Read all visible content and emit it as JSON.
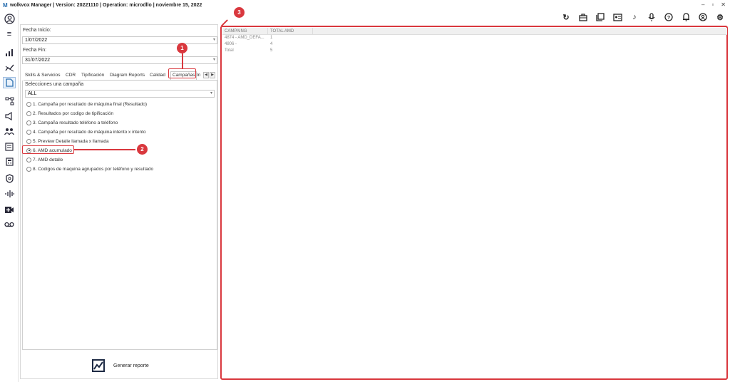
{
  "window": {
    "logo_letter": "M",
    "title": "wolkvox Manager  | Version: 20221110  |  Operation: microdllo  | noviembre 15, 2022",
    "controls": [
      "–",
      "▫",
      "✕"
    ]
  },
  "toolbar_icons": [
    "refresh-icon",
    "briefcase-icon",
    "book-icon",
    "contact-card-icon",
    "music-icon",
    "microphone-icon",
    "help-icon",
    "bell-icon",
    "user-icon",
    "settings-icon"
  ],
  "sidebar_icons": [
    "user-icon",
    "menu-icon",
    "bar-chart-icon",
    "line-chart-icon",
    "reports-icon",
    "org-chart-icon",
    "campaign-icon",
    "users-icon",
    "checklist-icon",
    "calculator-icon",
    "shield-icon",
    "waveform-icon",
    "video-icon",
    "voicemail-icon"
  ],
  "filters": {
    "fecha_inicio_label": "Fecha Inicio:",
    "fecha_inicio_value": "1/07/2022",
    "fecha_fin_label": "Fecha Fin:",
    "fecha_fin_value": "31/07/2022"
  },
  "tabs": [
    "Skills & Servicios",
    "CDR",
    "Tipificación",
    "Diagram Reports",
    "Calidad",
    "Campañas",
    "In"
  ],
  "selected_tab": "Campañas",
  "campaign": {
    "label": "Selecciones una campaña",
    "value": "ALL"
  },
  "reports": [
    {
      "label": "1. Campaña por resultado de máquina final (Resultado)",
      "checked": false
    },
    {
      "label": "2. Resultados por codigo de tipificación",
      "checked": false
    },
    {
      "label": "3. Campaña resultado teléfono a teléfono",
      "checked": false
    },
    {
      "label": "4. Campaña por resultado de máquina intento x intento",
      "checked": false
    },
    {
      "label": "5. Preview Detalle llamada x llamada",
      "checked": false
    },
    {
      "label": "6. AMD acumulado",
      "checked": true
    },
    {
      "label": "7. AMD detalle",
      "checked": false
    },
    {
      "label": "8. Codigos de maquina agrupados por teléfono y resultado",
      "checked": false
    }
  ],
  "generate_label": "Generar reporte",
  "table": {
    "headers": [
      "CAMPAING",
      "TOTAL AMD"
    ],
    "rows": [
      [
        "4874 - AMD_DEFA...",
        "1"
      ],
      [
        "4806 -",
        "4"
      ],
      [
        "Total",
        "5"
      ]
    ]
  },
  "callouts": [
    "1",
    "2",
    "3"
  ],
  "accent_color": "#d9383e"
}
